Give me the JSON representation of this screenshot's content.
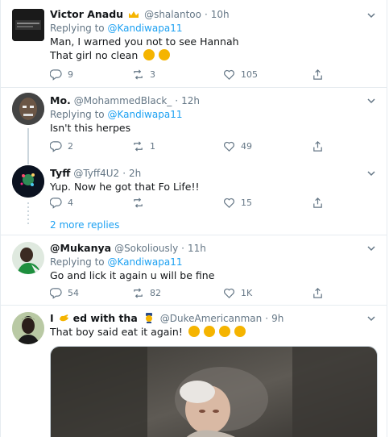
{
  "tweets": [
    {
      "display_name": "Victor Anadu",
      "handle": "@shalantoo",
      "time": "10h",
      "replying_label": "Replying to",
      "replying_to": "@Kandiwapa11",
      "lines": [
        "Man, I warned you not to see Hannah",
        "That girl no clean"
      ],
      "replies": "9",
      "retweets": "3",
      "likes": "105"
    },
    {
      "display_name": "Mo.",
      "handle": "@MohammedBlack_",
      "time": "12h",
      "replying_label": "Replying to",
      "replying_to": "@Kandiwapa11",
      "lines": [
        "Isn't this herpes"
      ],
      "replies": "2",
      "retweets": "1",
      "likes": "49"
    },
    {
      "display_name": "Tyff",
      "handle": "@Tyff4U2",
      "time": "2h",
      "lines": [
        "Yup. Now he got that Fo Life!!"
      ],
      "replies": "4",
      "retweets": "",
      "likes": "15"
    },
    {
      "display_name": "@Mukanya",
      "handle": "@Sokoliously",
      "time": "11h",
      "replying_label": "Replying to",
      "replying_to": "@Kandiwapa11",
      "lines": [
        "Go and lick it again u will be fine"
      ],
      "replies": "54",
      "retweets": "82",
      "likes": "1K"
    },
    {
      "display_name_a": "I",
      "display_name_b": "ed with tha",
      "handle": "@DukeAmericanman",
      "time": "9h",
      "lines": [
        "That boy said eat it again!"
      ]
    }
  ],
  "more_replies": "2 more replies",
  "separator": "·",
  "icons": {
    "reply": "reply-icon",
    "retweet": "retweet-icon",
    "like": "like-icon",
    "share": "share-icon",
    "caret": "chevron-down-icon"
  },
  "colors": {
    "accent": "#1da1f2",
    "muted": "#657786",
    "border": "#e6ecf0"
  }
}
